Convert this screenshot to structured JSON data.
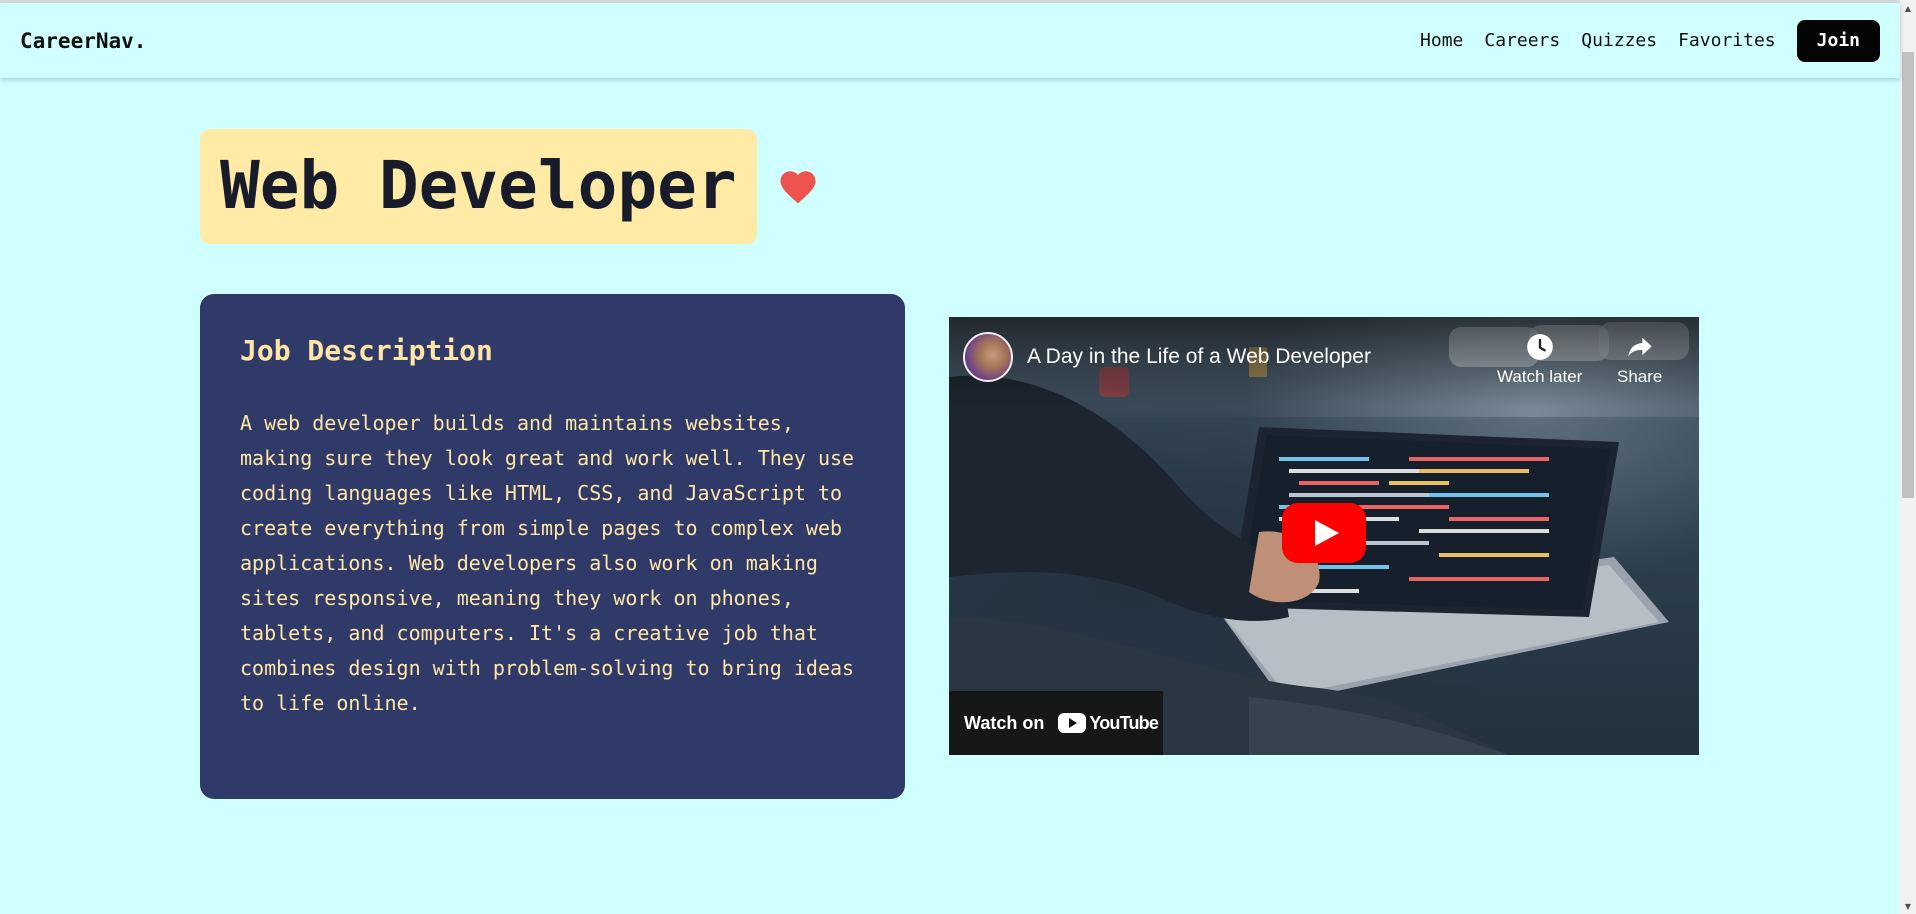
{
  "navbar": {
    "brand": "CareerNav.",
    "links": [
      {
        "label": "Home"
      },
      {
        "label": "Careers"
      },
      {
        "label": "Quizzes"
      },
      {
        "label": "Favorites"
      }
    ],
    "join_label": "Join"
  },
  "career": {
    "title": "Web Developer",
    "favorite_icon": "heart-icon",
    "favorite_color": "#ef5350",
    "title_bg": "#ffeaa6"
  },
  "description": {
    "heading": "Job Description",
    "body": "A web developer builds and maintains websites, making sure they look great and work well. They use coding languages like HTML, CSS, and JavaScript to create everything from simple pages to complex web applications. Web developers also work on making sites responsive, meaning they work on phones, tablets, and computers. It's a creative job that combines design with problem-solving to bring ideas to life online.",
    "card_bg": "#303a68",
    "text_color": "#ffe6a6"
  },
  "video": {
    "title": "A Day in the Life of a Web Developer",
    "watch_later_label": "Watch later",
    "share_label": "Share",
    "watch_on_label": "Watch on",
    "platform_label": "YouTube",
    "play_color": "#ff0000"
  },
  "colors": {
    "page_bg": "#cfffff",
    "join_bg": "#050505"
  }
}
